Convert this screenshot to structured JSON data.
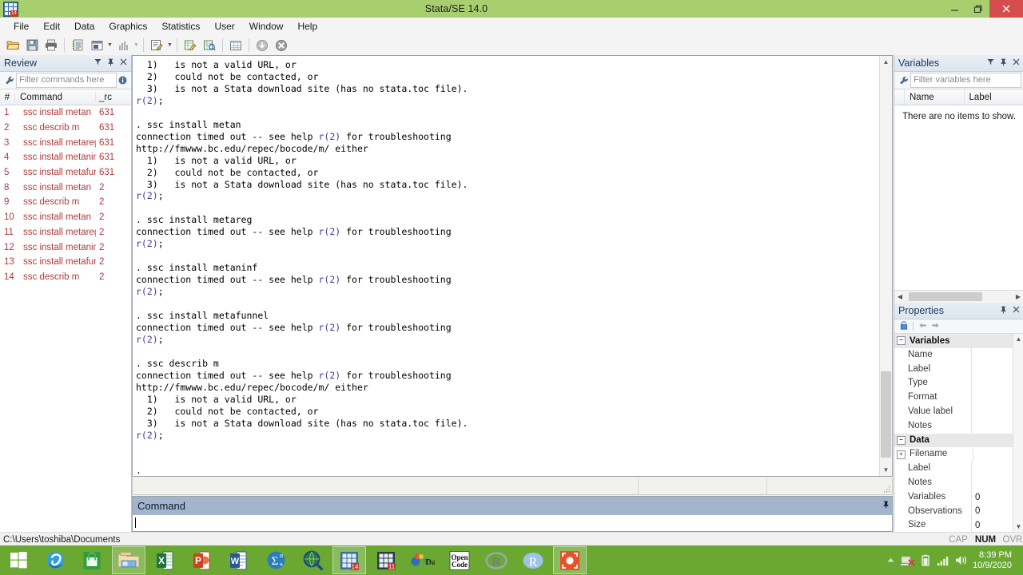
{
  "window": {
    "title": "Stata/SE 14.0",
    "app_icon": "stata-grid-icon",
    "app_badge": "14",
    "minimize": "minimize-icon",
    "maximize": "maximize-icon",
    "close": "close-icon"
  },
  "menubar": {
    "items": [
      "File",
      "Edit",
      "Data",
      "Graphics",
      "Statistics",
      "User",
      "Window",
      "Help"
    ]
  },
  "toolbar": {
    "buttons": [
      {
        "name": "open-file-button",
        "icon": "folder-open-icon",
        "enabled": true
      },
      {
        "name": "save-button",
        "icon": "floppy-disk-icon",
        "enabled": true
      },
      {
        "name": "print-button",
        "icon": "printer-icon",
        "enabled": true
      },
      {
        "name": "log-button",
        "icon": "log-notebook-icon",
        "enabled": true
      },
      {
        "name": "viewer-button",
        "icon": "viewer-window-icon",
        "enabled": true
      },
      {
        "name": "graph-button",
        "icon": "bar-chart-icon",
        "enabled": false
      },
      {
        "name": "do-editor-button",
        "icon": "do-file-editor-icon",
        "enabled": true
      },
      {
        "name": "data-editor-edit-button",
        "icon": "data-editor-edit-icon",
        "enabled": true
      },
      {
        "name": "data-editor-browse-button",
        "icon": "data-editor-browse-icon",
        "enabled": true
      },
      {
        "name": "variables-manager-button",
        "icon": "table-grid-icon",
        "enabled": true
      },
      {
        "name": "continue-button",
        "icon": "circle-down-arrow-icon",
        "enabled": true
      },
      {
        "name": "break-button",
        "icon": "circle-x-stop-icon",
        "enabled": true
      }
    ]
  },
  "review": {
    "title": "Review",
    "filter_placeholder": "Filter commands here",
    "columns": [
      "#",
      "Command",
      "_rc"
    ],
    "rows": [
      {
        "num": "1",
        "command": "ssc install metan",
        "rc": "631"
      },
      {
        "num": "2",
        "command": "ssc describ m",
        "rc": "631"
      },
      {
        "num": "3",
        "command": "ssc install metareg",
        "rc": "631"
      },
      {
        "num": "4",
        "command": "ssc install metaninf",
        "rc": "631"
      },
      {
        "num": "5",
        "command": "ssc install metafun...",
        "rc": "631"
      },
      {
        "num": "8",
        "command": "ssc install metan",
        "rc": "2"
      },
      {
        "num": "9",
        "command": "ssc describ m",
        "rc": "2"
      },
      {
        "num": "10",
        "command": "ssc install metan",
        "rc": "2"
      },
      {
        "num": "11",
        "command": "ssc install metareg",
        "rc": "2"
      },
      {
        "num": "12",
        "command": "ssc install metaninf",
        "rc": "2"
      },
      {
        "num": "13",
        "command": "ssc install metafun...",
        "rc": "2"
      },
      {
        "num": "14",
        "command": "ssc describ m",
        "rc": "2"
      }
    ]
  },
  "results": {
    "lines": [
      "  1)   is not a valid URL, or",
      "  2)   could not be contacted, or",
      "  3)   is not a Stata download site (has no stata.toc file).",
      "r(2);",
      "",
      ". ssc install metan",
      "connection timed out -- see help r(2) for troubleshooting",
      "http://fmwww.bc.edu/repec/bocode/m/ either",
      "  1)   is not a valid URL, or",
      "  2)   could not be contacted, or",
      "  3)   is not a Stata download site (has no stata.toc file).",
      "r(2);",
      "",
      ". ssc install metareg",
      "connection timed out -- see help r(2) for troubleshooting",
      "r(2);",
      "",
      ". ssc install metaninf",
      "connection timed out -- see help r(2) for troubleshooting",
      "r(2);",
      "",
      ". ssc install metafunnel",
      "connection timed out -- see help r(2) for troubleshooting",
      "r(2);",
      "",
      ". ssc describ m",
      "connection timed out -- see help r(2) for troubleshooting",
      "http://fmwww.bc.edu/repec/bocode/m/ either",
      "  1)   is not a valid URL, or",
      "  2)   could not be contacted, or",
      "  3)   is not a Stata download site (has no stata.toc file).",
      "r(2);",
      "",
      "",
      "."
    ],
    "link_color": "#3c3c9e"
  },
  "command_window": {
    "title": "Command",
    "value": "",
    "pin_icon": "pin-icon"
  },
  "variables": {
    "title": "Variables",
    "filter_placeholder": "Filter variables here",
    "columns": [
      "Name",
      "Label"
    ],
    "empty_message": "There are no items to show."
  },
  "properties": {
    "title": "Properties",
    "toolbar_icons": [
      "lock-icon",
      "back-arrow-icon",
      "forward-arrow-icon"
    ],
    "groups": [
      {
        "name": "Variables",
        "expander": "−",
        "rows": [
          {
            "label": "Name",
            "value": "",
            "expander": ""
          },
          {
            "label": "Label",
            "value": "",
            "expander": ""
          },
          {
            "label": "Type",
            "value": "",
            "expander": ""
          },
          {
            "label": "Format",
            "value": "",
            "expander": ""
          },
          {
            "label": "Value label",
            "value": "",
            "expander": ""
          },
          {
            "label": "Notes",
            "value": "",
            "expander": ""
          }
        ]
      },
      {
        "name": "Data",
        "expander": "−",
        "rows": [
          {
            "label": "Filename",
            "value": "",
            "expander": "+"
          },
          {
            "label": "Label",
            "value": "",
            "expander": ""
          },
          {
            "label": "Notes",
            "value": "",
            "expander": ""
          },
          {
            "label": "Variables",
            "value": "0",
            "expander": ""
          },
          {
            "label": "Observations",
            "value": "0",
            "expander": ""
          },
          {
            "label": "Size",
            "value": "0",
            "expander": ""
          }
        ]
      }
    ]
  },
  "statusbar": {
    "path": "C:\\Users\\toshiba\\Documents",
    "indicators": [
      {
        "label": "CAP",
        "active": false
      },
      {
        "label": "NUM",
        "active": true
      },
      {
        "label": "OVR",
        "active": false
      }
    ]
  },
  "taskbar": {
    "start": "windows-start-icon",
    "items": [
      {
        "name": "taskbar-internet-explorer",
        "icon": "internet-explorer-icon",
        "active": false
      },
      {
        "name": "taskbar-windows-store",
        "icon": "windows-store-icon",
        "active": false
      },
      {
        "name": "taskbar-file-explorer",
        "icon": "file-explorer-icon",
        "active": true
      },
      {
        "name": "taskbar-excel",
        "icon": "excel-icon",
        "active": false
      },
      {
        "name": "taskbar-powerpoint",
        "icon": "powerpoint-icon",
        "active": false
      },
      {
        "name": "taskbar-word",
        "icon": "word-icon",
        "active": false
      },
      {
        "name": "taskbar-spss-sigma",
        "icon": "sigma-alpha-icon",
        "active": false
      },
      {
        "name": "taskbar-search-globe",
        "icon": "magnifier-globe-icon",
        "active": false
      },
      {
        "name": "taskbar-stata-14",
        "icon": "stata-grid-icon",
        "badge": "14",
        "active": true
      },
      {
        "name": "taskbar-stata-11",
        "icon": "stata-grid-icon",
        "badge": "11",
        "active": false
      },
      {
        "name": "taskbar-geoda",
        "icon": "geoda-icon",
        "active": false
      },
      {
        "name": "taskbar-open-code",
        "icon": "open-code-icon",
        "label": "Open Code",
        "active": false
      },
      {
        "name": "taskbar-rstudio",
        "icon": "rstudio-icon",
        "active": false
      },
      {
        "name": "taskbar-r",
        "icon": "r-icon",
        "active": false
      },
      {
        "name": "taskbar-screen-recorder",
        "icon": "screen-recorder-icon",
        "active": true
      }
    ],
    "tray": [
      "show-hidden-icons-chevron",
      "network-error-icon",
      "battery-icon",
      "signal-bars-icon",
      "volume-icon"
    ],
    "clock_time": "8:39 PM",
    "clock_date": "10/9/2020"
  }
}
